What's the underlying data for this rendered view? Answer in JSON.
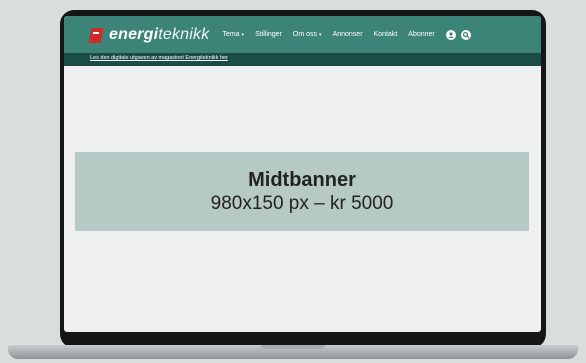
{
  "site": {
    "logo_part1": "energi",
    "logo_part2": "teknikk"
  },
  "nav": {
    "items": [
      {
        "label": "Tema",
        "has_dropdown": true
      },
      {
        "label": "Stillinger",
        "has_dropdown": false
      },
      {
        "label": "Om oss",
        "has_dropdown": true
      },
      {
        "label": "Annonser",
        "has_dropdown": false
      },
      {
        "label": "Kontakt",
        "has_dropdown": false
      },
      {
        "label": "Abonner",
        "has_dropdown": false
      }
    ],
    "caret": "▾",
    "icons": [
      "user-icon",
      "search-icon"
    ]
  },
  "subbar": {
    "link_text": "Les den digitale utgaven av magasinet Energiteknikk her"
  },
  "banner": {
    "title": "Midtbanner",
    "subtitle": "980x150 px – kr 5000"
  },
  "colors": {
    "header": "#3c8478",
    "subbar": "#1b4d46",
    "banner_bg": "#b7c9c4",
    "logo_accent": "#d02a2a",
    "page_bg": "#d7dedb"
  }
}
